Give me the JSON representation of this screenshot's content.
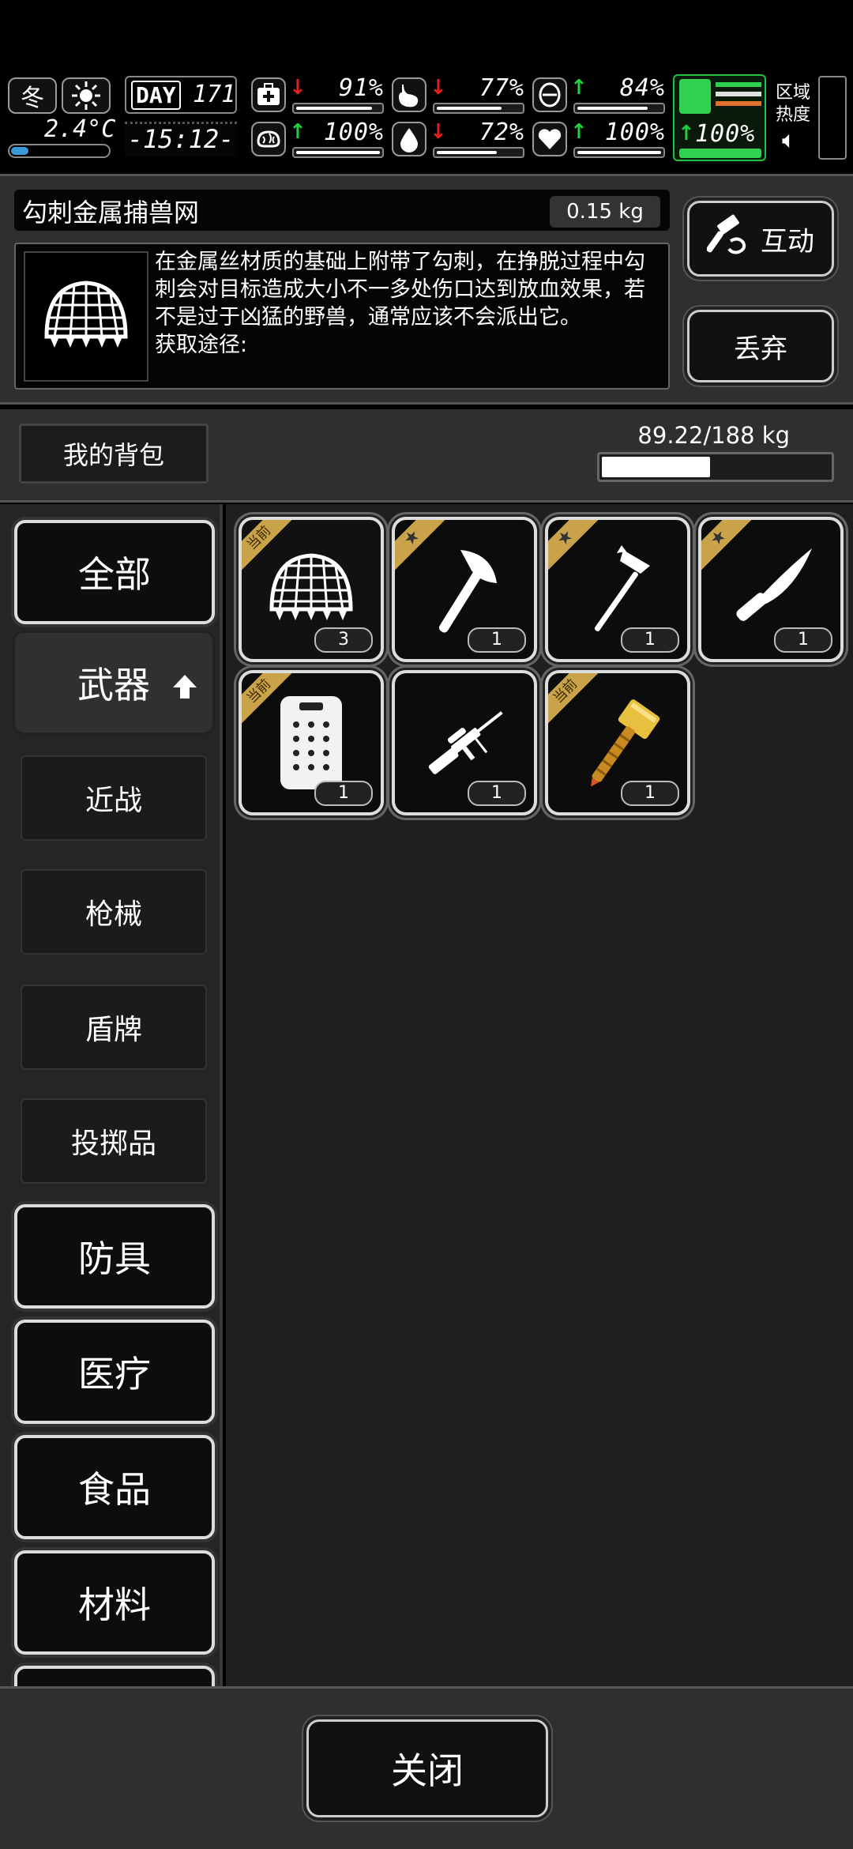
{
  "status": {
    "season": "冬",
    "weather_icon": "sun-icon",
    "temperature": "2.4°C",
    "day_label": "DAY",
    "day": "171",
    "time": "-15:12-",
    "stats": [
      {
        "icon": "medkit-icon",
        "trend": "down",
        "value": "91%",
        "level": 0.91
      },
      {
        "icon": "stomach-icon",
        "trend": "down",
        "value": "77%",
        "level": 0.77
      },
      {
        "icon": "stamina-icon",
        "trend": "up",
        "value": "84%",
        "level": 0.84
      },
      {
        "icon": "brain-icon",
        "trend": "up",
        "value": "100%",
        "level": 1.0
      },
      {
        "icon": "water-drop-icon",
        "trend": "down",
        "value": "72%",
        "level": 0.72
      },
      {
        "icon": "heart-icon",
        "trend": "up",
        "value": "100%",
        "level": 1.0
      }
    ],
    "stamina_value": "100%",
    "area_heat_label": "区域热度"
  },
  "detail": {
    "item_name": "勾刺金属捕兽网",
    "item_weight": "0.15 kg",
    "description": "在金属丝材质的基础上附带了勾刺，在挣脱过程中勾刺会对目标造成大小不一多处伤口达到放血效果，若不是过于凶猛的野兽，通常应该不会派出它。",
    "source_label": "获取途径:",
    "interact_label": "互动",
    "drop_label": "丢弃"
  },
  "bag": {
    "label": "我的背包",
    "weight": "89.22/188 kg",
    "fill": 0.4746
  },
  "categories": {
    "all": "全部",
    "weapons": "武器",
    "weapons_sub": [
      "近战",
      "枪械",
      "盾牌",
      "投掷品"
    ],
    "armor": "防具",
    "medical": "医疗",
    "food": "食品",
    "materials": "材料"
  },
  "items": [
    {
      "name": "net-item",
      "badge": "当前",
      "count": "3"
    },
    {
      "name": "axe-item",
      "badge": "★",
      "count": "1"
    },
    {
      "name": "pickaxe-item",
      "badge": "★",
      "count": "1"
    },
    {
      "name": "knife-item",
      "badge": "★",
      "count": "1"
    },
    {
      "name": "riot-shield-item",
      "badge": "当前",
      "count": "1"
    },
    {
      "name": "sniper-rifle-item",
      "badge": "",
      "count": "1"
    },
    {
      "name": "hammer-item",
      "badge": "当前",
      "count": "1"
    }
  ],
  "close_label": "关闭"
}
